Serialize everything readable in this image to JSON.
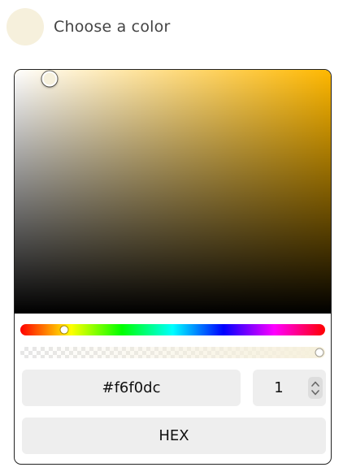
{
  "header": {
    "title": "Choose a color",
    "swatch_color": "#f6f0dc"
  },
  "picker": {
    "hue_color": "#ffb800",
    "saturation": 0.11,
    "value": 0.965,
    "hue_position": 0.145,
    "alpha_position": 1.0,
    "hex_value": "#f6f0dc",
    "alpha_value": "1",
    "format_label": "HEX"
  }
}
